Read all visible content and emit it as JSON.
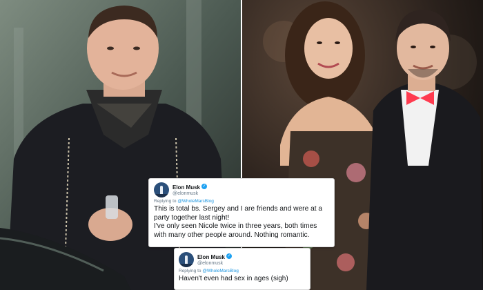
{
  "photos": {
    "left_alt": "Elon Musk",
    "right_alt": "Nicole Shanahan and Sergey Brin"
  },
  "tweets": [
    {
      "name": "Elon Musk",
      "handle": "@elonmusk",
      "replying_prefix": "Replying to ",
      "replying_to": "@WholeMarsBlog",
      "text_1": "This is total bs. Sergey and I are friends and were at a party together last night!",
      "text_2": "I've only seen Nicole twice in three years, both times with many other people around. Nothing romantic."
    },
    {
      "name": "Elon Musk",
      "handle": "@elonmusk",
      "replying_prefix": "Replying to ",
      "replying_to": "@WholeMarsBlog",
      "text_1": "Haven't even had sex in ages (sigh)"
    }
  ],
  "icons": {
    "verified": "verified-badge-icon",
    "avatar": "rocket-avatar-icon"
  },
  "colors": {
    "twitter_blue": "#1da1f2",
    "link_blue": "#1b95e0",
    "bow_tie": "#ff3b4f"
  }
}
